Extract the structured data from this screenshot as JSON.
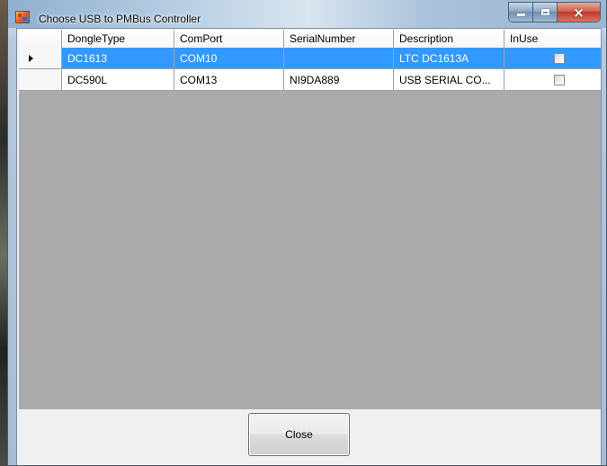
{
  "window": {
    "title": "Choose USB to PMBus Controller",
    "icon": "app-icon",
    "controls": {
      "minimize": "minimize-icon",
      "maximize": "maximize-icon",
      "close": "×"
    }
  },
  "grid": {
    "columns": [
      "DongleType",
      "ComPort",
      "SerialNumber",
      "Description",
      "InUse"
    ],
    "rows": [
      {
        "dongle_type": "DC1613",
        "com_port": "COM10",
        "serial_number": "",
        "description": "LTC DC1613A",
        "in_use": false,
        "selected": true
      },
      {
        "dongle_type": "DC590L",
        "com_port": "COM13",
        "serial_number": "NI9DA889",
        "description": "USB SERIAL CO...",
        "in_use": false,
        "selected": false
      }
    ]
  },
  "footer": {
    "close_label": "Close"
  },
  "colors": {
    "selection": "#3399ff",
    "grid_background": "#ababab"
  }
}
